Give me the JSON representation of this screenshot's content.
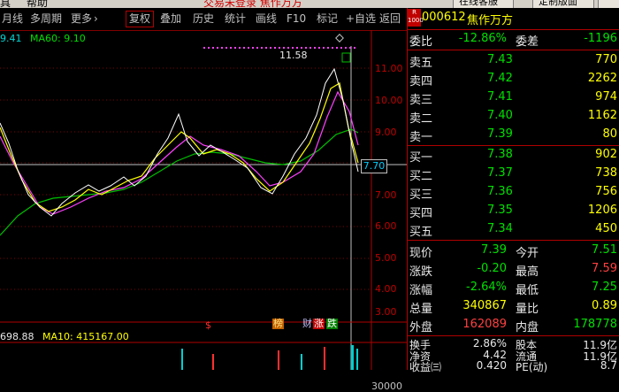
{
  "window": {
    "menu_view": "具",
    "menu_help": "帮助",
    "title": "交易未登录  焦作万方",
    "btn_online": "在线客服",
    "btn_custom": "定制版面"
  },
  "toolbar": {
    "period_month": "月线",
    "multi_period": "多周期",
    "more": "更多",
    "restore": "复权",
    "overlay": "叠加",
    "history": "历史",
    "stats": "统计",
    "draw_line": "画线",
    "f10": "F10",
    "mark": "标记",
    "add_watch": "+自选",
    "back": "返回"
  },
  "chart": {
    "legend_main_left": "9.41",
    "legend_ma60": "MA60: 9.10",
    "peak_label": "11.58",
    "current_price_tag": "7.70",
    "y_labels": [
      "11.00",
      "10.00",
      "9.00",
      "8.00",
      "7.00",
      "6.00",
      "5.00",
      "4.00",
      "3.00"
    ],
    "volume_legend_left": "698.88",
    "volume_legend_ma10": "MA10: 415167.00",
    "volume_axis_label": "30000",
    "bottom_markers": [
      "$",
      "榜",
      "财",
      "涨",
      "跌"
    ],
    "colors": {
      "up": "#ff3030",
      "down": "#00d0d0",
      "ma5": "#ffffff",
      "ma10": "#ffff00",
      "ma20": "#ff40ff",
      "ma60": "#00d000"
    }
  },
  "quote": {
    "badge_top": "R",
    "badge_bottom": "1000",
    "code": "000612",
    "name": "焦作万方",
    "wei_bi_label": "委比",
    "wei_bi_value": "-12.86%",
    "wei_cha_label": "委差",
    "wei_cha_value": "-1196",
    "asks": [
      {
        "label": "卖五",
        "price": "7.43",
        "vol": "770"
      },
      {
        "label": "卖四",
        "price": "7.42",
        "vol": "2262"
      },
      {
        "label": "卖三",
        "price": "7.41",
        "vol": "974"
      },
      {
        "label": "卖二",
        "price": "7.40",
        "vol": "1162"
      },
      {
        "label": "卖一",
        "price": "7.39",
        "vol": "80"
      }
    ],
    "bids": [
      {
        "label": "买一",
        "price": "7.38",
        "vol": "902"
      },
      {
        "label": "买二",
        "price": "7.37",
        "vol": "738"
      },
      {
        "label": "买三",
        "price": "7.36",
        "vol": "756"
      },
      {
        "label": "买四",
        "price": "7.35",
        "vol": "1206"
      },
      {
        "label": "买五",
        "price": "7.34",
        "vol": "450"
      }
    ],
    "stats": [
      {
        "l1": "现价",
        "v1": "7.39",
        "l2": "今开",
        "v2": "7.51"
      },
      {
        "l1": "涨跌",
        "v1": "-0.20",
        "l2": "最高",
        "v2": "7.59"
      },
      {
        "l1": "涨幅",
        "v1": "-2.64%",
        "l2": "最低",
        "v2": "7.25"
      },
      {
        "l1": "总量",
        "v1": "340867",
        "l2": "量比",
        "v2": "0.89"
      },
      {
        "l1": "外盘",
        "v1": "162089",
        "l2": "内盘",
        "v2": "178778"
      }
    ],
    "fund": [
      {
        "l1": "换手",
        "v1": "2.86%",
        "l2": "股本",
        "v2": "11.9亿"
      },
      {
        "l1": "净资",
        "v1": "4.42",
        "l2": "流通",
        "v2": "11.9亿"
      },
      {
        "l1": "收益㈢",
        "v1": "0.420",
        "l2": "PE(动)",
        "v2": "8.7"
      }
    ]
  }
}
